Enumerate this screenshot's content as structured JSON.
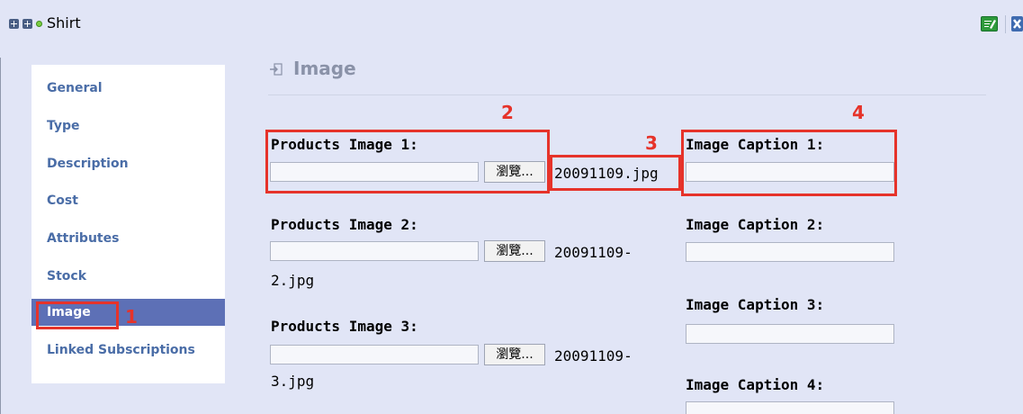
{
  "window": {
    "title": "Shirt"
  },
  "sidebar": {
    "items": [
      {
        "label": "General"
      },
      {
        "label": "Type"
      },
      {
        "label": "Description"
      },
      {
        "label": "Cost"
      },
      {
        "label": "Attributes"
      },
      {
        "label": "Stock"
      },
      {
        "label": "Image"
      },
      {
        "label": "Linked Subscriptions"
      }
    ],
    "active": "Image"
  },
  "section": {
    "title": "Image"
  },
  "images": [
    {
      "label": "Products Image 1:",
      "browse": "瀏覽...",
      "filename": "20091109.jpg"
    },
    {
      "label": "Products Image 2:",
      "browse": "瀏覽...",
      "filename_line1": "20091109-",
      "filename_line2": "2.jpg"
    },
    {
      "label": "Products Image 3:",
      "browse": "瀏覽...",
      "filename_line1": "20091109-",
      "filename_line2": "3.jpg"
    }
  ],
  "captions": [
    {
      "label": "Image Caption 1:",
      "value": ""
    },
    {
      "label": "Image Caption 2:",
      "value": ""
    },
    {
      "label": "Image Caption 3:",
      "value": ""
    },
    {
      "label": "Image Caption 4:",
      "value": ""
    }
  ],
  "annotations": [
    "1",
    "2",
    "3",
    "4"
  ],
  "colors": {
    "accent": "#5d70b6",
    "annotation": "#e6332a",
    "link": "#4a6da7",
    "background": "#e1e5f6"
  }
}
